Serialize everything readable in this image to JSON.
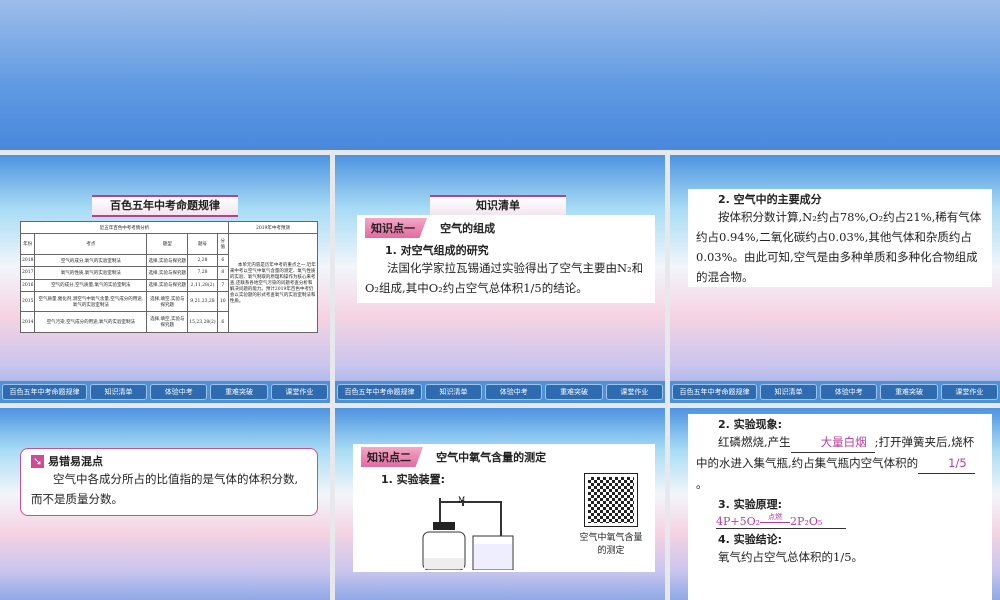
{
  "nav": [
    "百色五年中考命题规律",
    "知识清单",
    "体验中考",
    "重难突破",
    "课堂作业"
  ],
  "s1": {
    "banner": "百色五年中考命题规律",
    "table_title": "近五年百色中考考情分析",
    "predict_title": "2019年中考预测",
    "headers": [
      "年份",
      "考点",
      "题型",
      "题号",
      "分值"
    ],
    "rows": [
      [
        "2018",
        "空气的成分,氧气的实验室制法",
        "选择,实验与探究题",
        "2,28",
        "6"
      ],
      [
        "2017",
        "氧气的性质,氧气的实验室制法",
        "选择,实验与探究题",
        "7,28",
        "8"
      ],
      [
        "2016",
        "空气的成分,空气质量,氧气的实验室制法",
        "选择,实验与探究题",
        "2,11,28(2)",
        "7"
      ],
      [
        "2015",
        "空气质量,催化剂,测空气中氧气含量,空气成分的用途,氧气的实验室制法",
        "选择,填空,实验与探究题",
        "9,21,23,28",
        "10"
      ],
      [
        "2014",
        "空气污染,空气成分的用途,氧气的实验室制法",
        "选择,填空,实验与探究题",
        "15,23,28(2)",
        "6"
      ]
    ],
    "prediction": "本单元内容是历年中考的重点之一,近年来中考以空气中氧气含量的测定、氧气性质的实验、氧气制取的原理和操作为核心来考查,还联系各地空气污染的问题考查分析和解决问题的能力。预计2019年百色中考仍会以实验题的形式考查氧气的实验室制法和性质。"
  },
  "s2": {
    "banner": "知识清单",
    "tag": "知识点一",
    "title": "空气的组成",
    "h1": "1. 对空气组成的研究",
    "p": "法国化学家拉瓦锡通过实验得出了空气主要由N₂和O₂组成,其中O₂约占空气总体积1/5的结论。"
  },
  "s3": {
    "h": "2. 空气中的主要成分",
    "p": "按体积分数计算,N₂约占78%,O₂约占21%,稀有气体约占0.94%,二氧化碳约占0.03%,其他气体和杂质约占0.03%。由此可知,空气是由多种单质和多种化合物组成的混合物。"
  },
  "s4": {
    "title": "易错易混点",
    "p": "空气中各成分所占的比值指的是气体的体积分数,而不是质量分数。"
  },
  "s5": {
    "tag": "知识点二",
    "title": "空气中氧气含量的测定",
    "h": "1. 实验装置:",
    "clip": "M",
    "qr_caption": "空气中氧气含量的测定"
  },
  "s6": {
    "h2": "2. 实验现象:",
    "p2a": "红磷燃烧,产生",
    "fill1": "大量白烟",
    "p2b": ";打开弹簧夹后,烧杯中的水进入集气瓶,约占集气瓶内空气体积的",
    "fill2": "1/5",
    "p2c": "。",
    "h3": "3. 实验原理:",
    "eq": "4P+5O₂",
    "cond": "点燃",
    "prod": "2P₂O₅",
    "h4": "4. 实验结论:",
    "p4": "氧气约占空气总体积的1/5。"
  }
}
